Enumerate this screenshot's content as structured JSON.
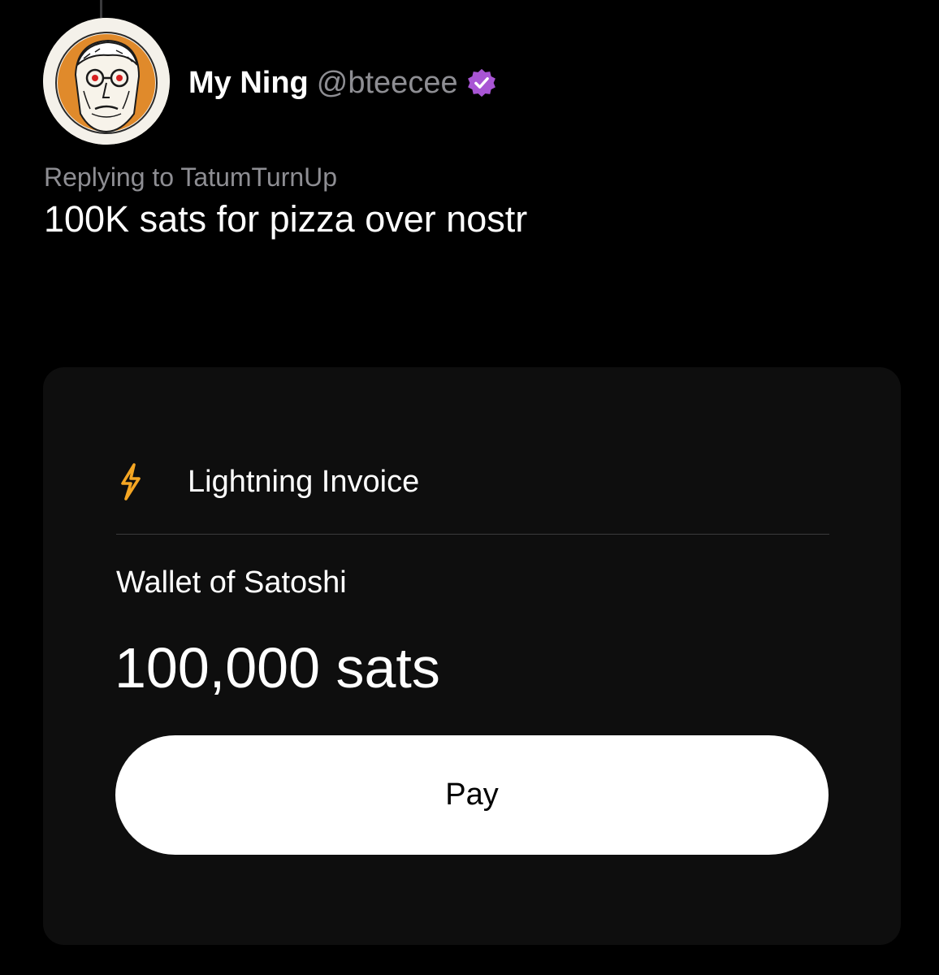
{
  "post": {
    "author": {
      "display_name": "My Ning",
      "handle": "@bteecee",
      "verified_badge_icon": "verified-badge-icon",
      "avatar_icon": "cartoon-portrait-avatar"
    },
    "reply_context": {
      "prefix": "Replying to",
      "user": "TatumTurnUp"
    },
    "text": "100K sats for pizza over nostr"
  },
  "invoice": {
    "icon": "lightning-bolt-icon",
    "title": "Lightning Invoice",
    "wallet": "Wallet of Satoshi",
    "amount": "100,000 sats",
    "pay_label": "Pay"
  },
  "colors": {
    "background": "#000000",
    "card": "#0e0e0e",
    "muted_text": "#8e8e93",
    "verified": "#a855d4",
    "bolt": "#f5a623",
    "avatar_accent": "#e08a2b"
  }
}
